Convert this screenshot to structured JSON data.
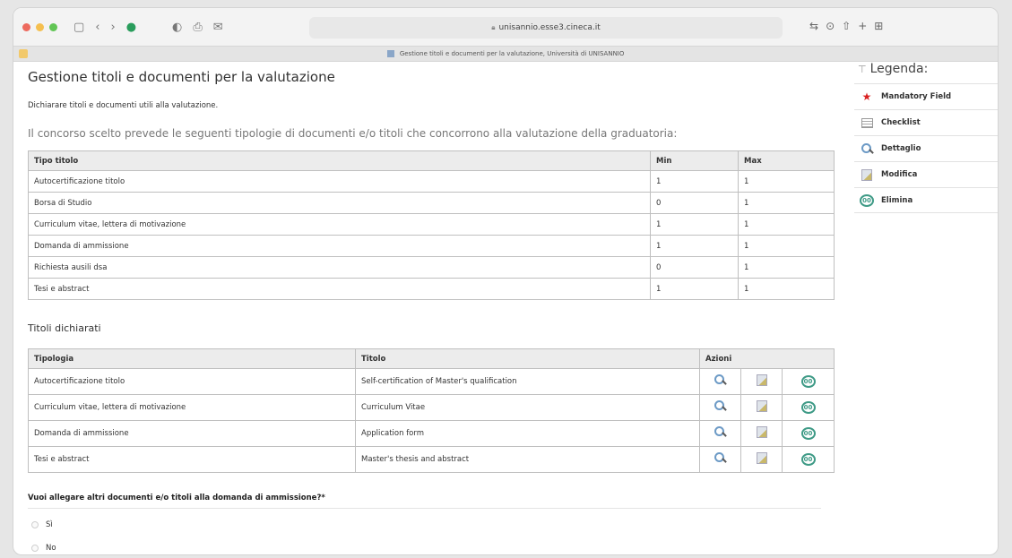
{
  "browser": {
    "url": "unisannio.esse3.cineca.it",
    "tab_title": "Gestione titoli e documenti per la valutazione, Università di UNISANNIO",
    "traffic_lights": [
      "#ed6a5e",
      "#f5bf4f",
      "#61c554"
    ]
  },
  "page": {
    "title": "Gestione titoli e documenti per la valutazione",
    "intro": "Dichiarare titoli e documenti utili alla valutazione.",
    "lead": "Il concorso scelto prevede le seguenti tipologie di documenti e/o titoli che concorrono alla valutazione della graduatoria:"
  },
  "types_table": {
    "headers": [
      "Tipo titolo",
      "Min",
      "Max"
    ],
    "rows": [
      {
        "tipo": "Autocertificazione titolo",
        "min": "1",
        "max": "1"
      },
      {
        "tipo": "Borsa di Studio",
        "min": "0",
        "max": "1"
      },
      {
        "tipo": "Curriculum vitae, lettera di motivazione",
        "min": "1",
        "max": "1"
      },
      {
        "tipo": "Domanda di ammissione",
        "min": "1",
        "max": "1"
      },
      {
        "tipo": "Richiesta ausili dsa",
        "min": "0",
        "max": "1"
      },
      {
        "tipo": "Tesi e abstract",
        "min": "1",
        "max": "1"
      }
    ]
  },
  "declared": {
    "section_title": "Titoli dichiarati",
    "headers": [
      "Tipologia",
      "Titolo",
      "Azioni"
    ],
    "rows": [
      {
        "tipologia": "Autocertificazione titolo",
        "titolo": "Self-certification of Master's qualification"
      },
      {
        "tipologia": "Curriculum vitae, lettera di motivazione",
        "titolo": "Curriculum Vitae"
      },
      {
        "tipologia": "Domanda di ammissione",
        "titolo": "Application form"
      },
      {
        "tipologia": "Tesi e abstract",
        "titolo": "Master's thesis and abstract"
      }
    ],
    "delete_icon_text": "00"
  },
  "question": {
    "label": "Vuoi allegare altri documenti e/o titoli alla domanda di ammissione?*",
    "options": [
      "Sì",
      "No"
    ]
  },
  "legend": {
    "title": "Legenda:",
    "items": [
      {
        "label": "Mandatory Field",
        "icon": "star-icon"
      },
      {
        "label": "Checklist",
        "icon": "checklist-icon"
      },
      {
        "label": "Dettaglio",
        "icon": "search-icon"
      },
      {
        "label": "Modifica",
        "icon": "edit-icon"
      },
      {
        "label": "Elimina",
        "icon": "delete-icon"
      }
    ]
  }
}
